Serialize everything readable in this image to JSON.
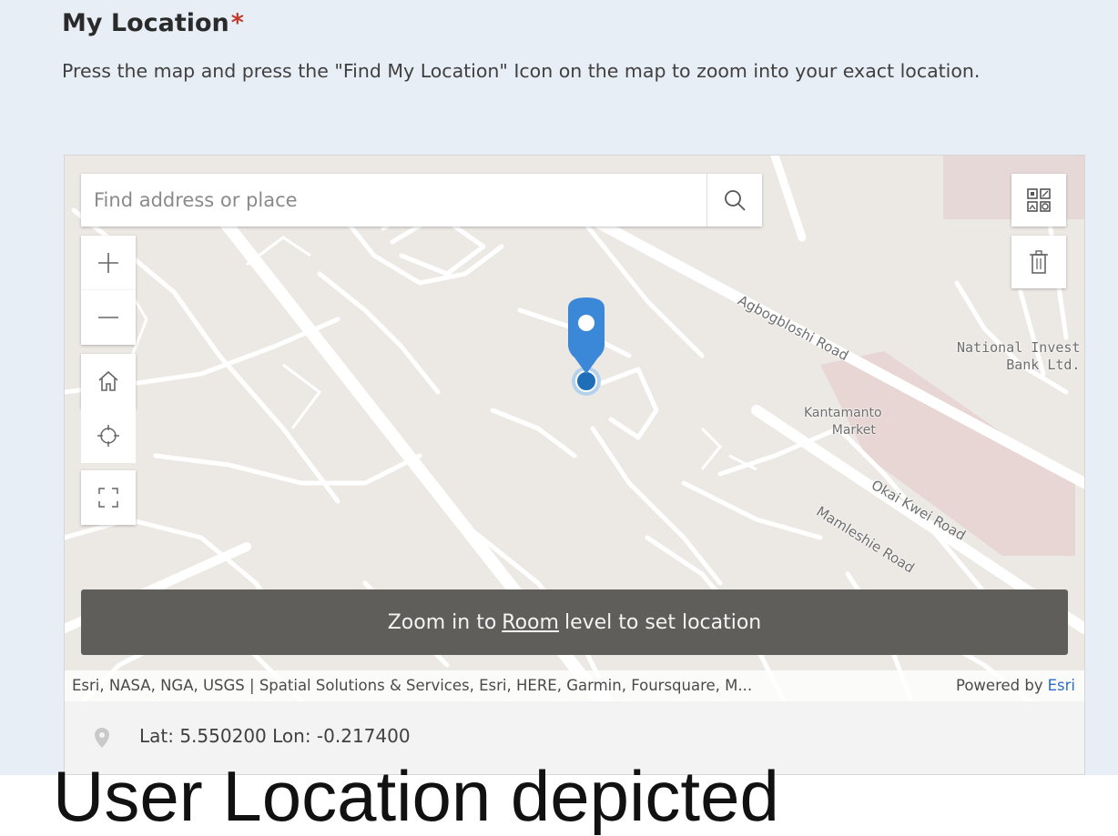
{
  "question": {
    "title": "My Location",
    "required_mark": "*",
    "description": "Press the map and press the \"Find My Location\" Icon on the map to zoom into your exact location."
  },
  "map": {
    "search_placeholder": "Find address or place",
    "labels": {
      "road1": "Agbogbloshi Road",
      "poi1_line1": "National Invest",
      "poi1_line2": "Bank Ltd.",
      "market_line1": "Kantamanto",
      "market_line2": "Market",
      "road2": "Okai Kwei Road",
      "road3": "Mamleshie Road"
    },
    "controls": [
      "zoom-in",
      "zoom-out",
      "home",
      "locate",
      "fullscreen",
      "basemap-gallery",
      "delete"
    ],
    "banner": {
      "prefix": "Zoom in to",
      "level": "Room",
      "suffix": "level to set location"
    },
    "attribution": {
      "sources": "Esri, NASA, NGA, USGS | Spatial Solutions & Services, Esri, HERE, Garmin, Foursquare, M...",
      "powered_by": "Powered by",
      "powered_link": "Esri"
    }
  },
  "location": {
    "text": "Lat: 5.550200  Lon: -0.217400"
  },
  "caption": "User Location depicted",
  "colors": {
    "panel_bg": "#e8eef6",
    "map_bg": "#ece9e5",
    "pin_blue": "#3b87d8",
    "banner_bg": "#5f5e5b",
    "required_red": "#c0392b",
    "esri_link": "#2d6ec1"
  }
}
